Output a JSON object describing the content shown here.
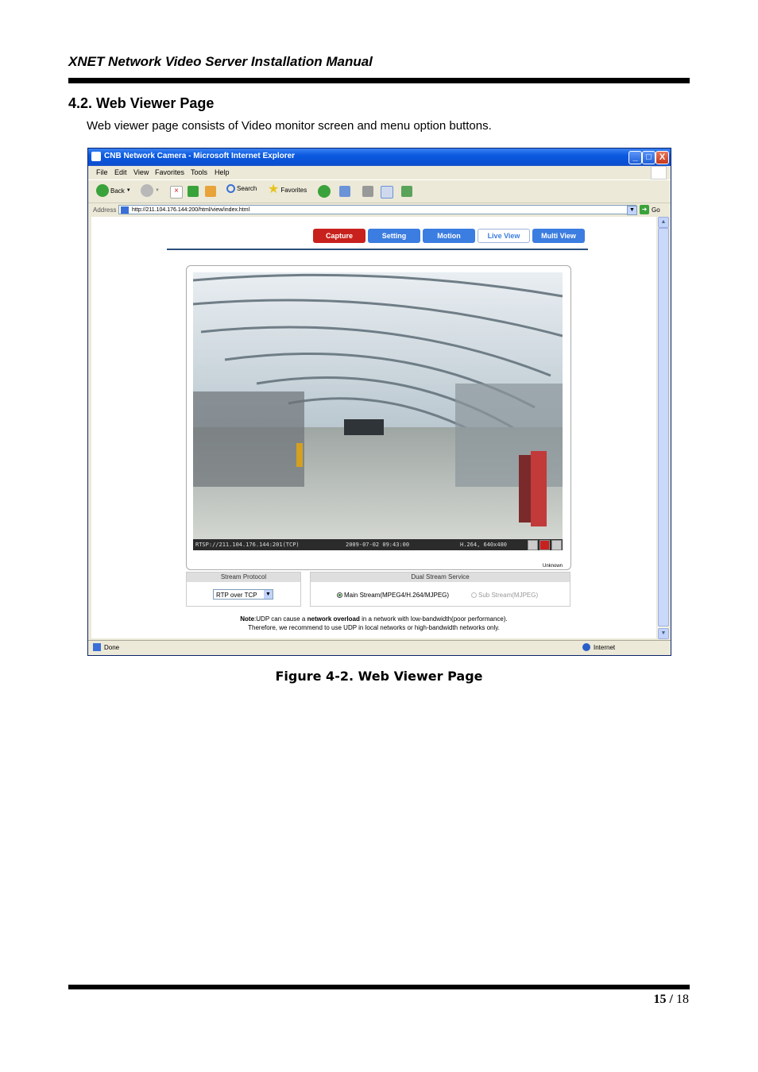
{
  "document": {
    "header": "XNET Network Video Server Installation Manual",
    "section_title": "4.2. Web Viewer Page",
    "intro": "Web viewer page consists of Video monitor screen and menu option buttons.",
    "figure_caption": "Figure 4-2. Web Viewer Page",
    "page_current": "15",
    "page_separator": "/",
    "page_total": "18"
  },
  "browser": {
    "title": "CNB Network Camera - Microsoft Internet Explorer",
    "window_buttons": [
      "_",
      "□",
      "X"
    ],
    "menu": [
      "File",
      "Edit",
      "View",
      "Favorites",
      "Tools",
      "Help"
    ],
    "toolbar": {
      "back": "Back",
      "search": "Search",
      "favorites": "Favorites"
    },
    "address_label": "Address",
    "address_url": "http://211.104.176.144:200/html/view/index.html",
    "go_label": "Go",
    "status_left": "Done",
    "status_zone": "Internet"
  },
  "camera_page": {
    "nav": [
      "Capture",
      "Setting",
      "Motion",
      "Live View",
      "Multi View"
    ],
    "osd": {
      "stream": "RTSP://211.104.176.144:201(TCP)",
      "datetime": "2009-07-02 09:43:00",
      "codec": "H.264, 640x480",
      "unknown": "Unknown"
    },
    "stream_protocol": {
      "title": "Stream Protocol",
      "selected": "RTP over TCP"
    },
    "dual_stream": {
      "title": "Dual Stream Service",
      "main": "Main Stream(MPEG4/H.264/MJPEG)",
      "sub": "Sub Stream(MJPEG)"
    },
    "note": {
      "label": "Note",
      "line1_a": ":UDP can cause a ",
      "line1_b": "network overload",
      "line1_c": " in a network with low-bandwidth(poor performance).",
      "line2": "Therefore, we recommend to use UDP in local networks or high-bandwidth networks only."
    }
  }
}
